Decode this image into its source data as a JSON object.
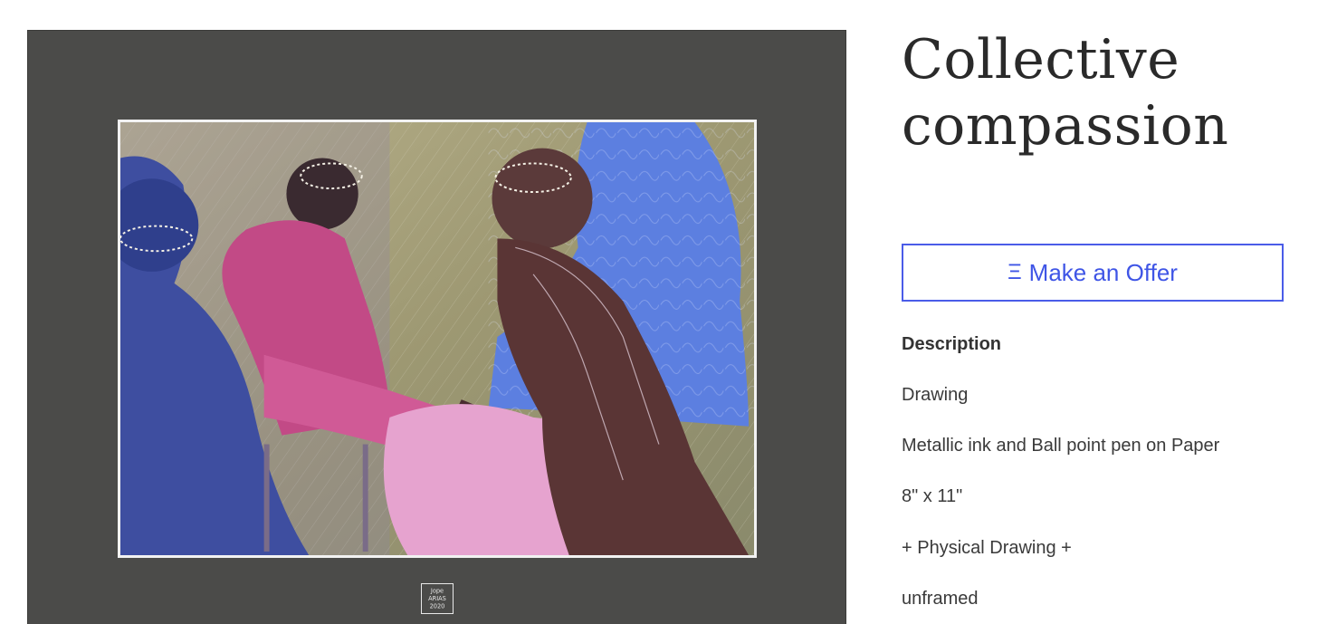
{
  "artwork": {
    "title_lines": [
      "Collective",
      "compassion"
    ],
    "image_description_icon": "artwork-image",
    "signature_icon": "signature-stamp-icon",
    "signature_text": [
      "Jope",
      "ARIAS",
      "2020"
    ]
  },
  "offer": {
    "icon": "Ξ",
    "label": "Make an Offer",
    "color": "#3f55e6"
  },
  "description": {
    "heading": "Description",
    "lines": [
      "Drawing",
      "Metallic ink and Ball point pen on Paper",
      "8\" x 11\"",
      "+ Physical Drawing +",
      "unframed"
    ]
  },
  "colors": {
    "mat": "#4b4b49",
    "accent": "#4a5ce8"
  }
}
